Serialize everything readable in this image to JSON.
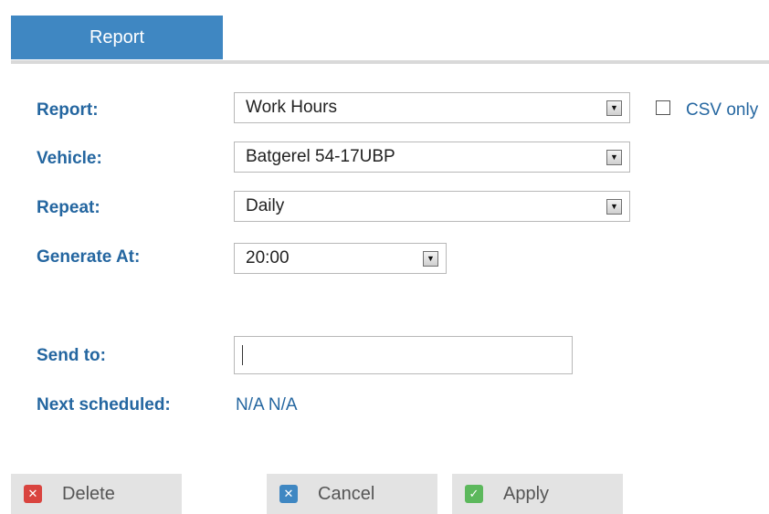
{
  "tab": {
    "label": "Report"
  },
  "form": {
    "report": {
      "label": "Report:",
      "value": "Work Hours"
    },
    "csv_only": {
      "label": "CSV only",
      "checked": false
    },
    "vehicle": {
      "label": "Vehicle:",
      "value": "Batgerel 54-17UBP"
    },
    "repeat": {
      "label": "Repeat:",
      "value": "Daily"
    },
    "generate_at": {
      "label": "Generate At:",
      "value": "20:00"
    },
    "send_to": {
      "label": "Send to:",
      "value": ""
    },
    "next_scheduled": {
      "label": "Next scheduled:",
      "value": "N/A N/A"
    }
  },
  "buttons": {
    "delete": {
      "label": "Delete",
      "icon": "x-icon",
      "color": "#d9443f"
    },
    "cancel": {
      "label": "Cancel",
      "icon": "x-icon",
      "color": "#3f87c2"
    },
    "apply": {
      "label": "Apply",
      "icon": "check-icon",
      "color": "#5cb85c"
    }
  },
  "colors": {
    "accent": "#3f87c2",
    "label": "#2466a0"
  }
}
